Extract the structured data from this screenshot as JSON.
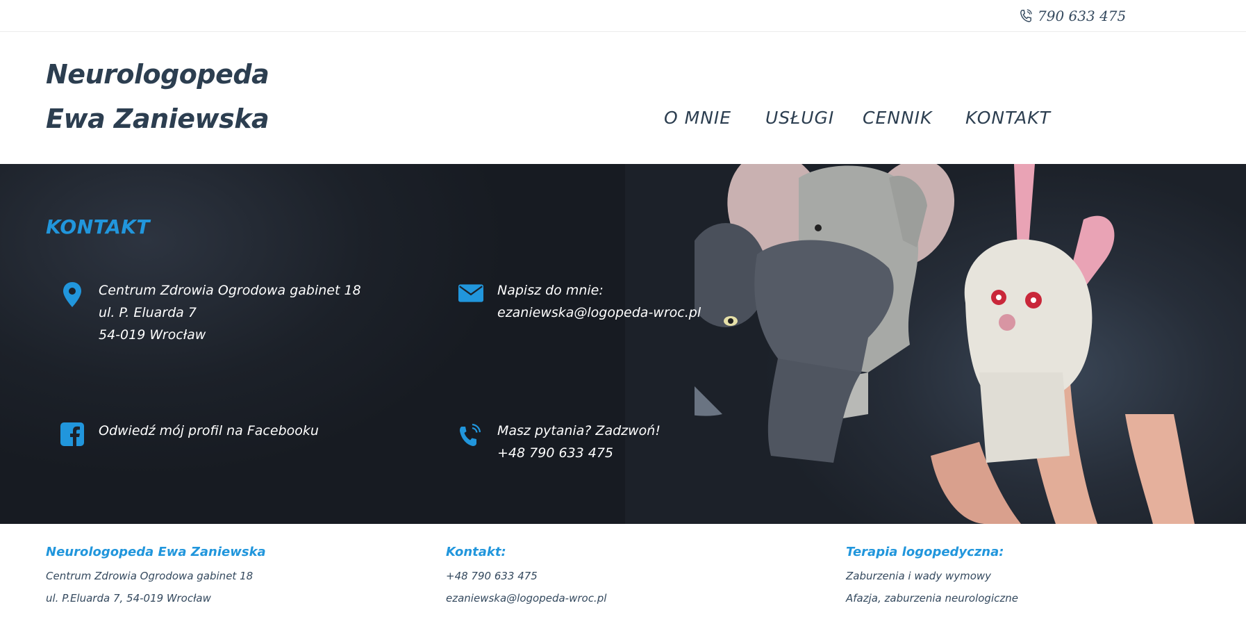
{
  "topbar": {
    "phone": "790 633 475",
    "phone_icon": "phone-icon"
  },
  "header": {
    "logo_line1": "Neurologopeda",
    "logo_line2": "Ewa Zaniewska",
    "nav": [
      {
        "label": "O MNIE"
      },
      {
        "label": "USŁUGI"
      },
      {
        "label": "CENNIK"
      },
      {
        "label": "KONTAKT"
      }
    ]
  },
  "contact": {
    "title": "KONTAKT",
    "address": {
      "icon": "map-pin-icon",
      "lines": [
        "Centrum Zdrowia Ogrodowa gabinet 18",
        "ul. P. Eluarda 7",
        "54-019 Wrocław"
      ]
    },
    "mail": {
      "icon": "envelope-icon",
      "lines": [
        "Napisz do mnie:",
        "ezaniewska@logopeda-wroc.pl"
      ]
    },
    "facebook": {
      "icon": "facebook-icon",
      "lines": [
        "Odwiedź mój profil na Facebooku"
      ]
    },
    "phone": {
      "icon": "phone-ringing-icon",
      "lines": [
        "Masz pytania? Zadzwoń!",
        "+48 790 633 475"
      ]
    }
  },
  "footer": {
    "col1": {
      "heading": "Neurologopeda Ewa Zaniewska",
      "lines": [
        "Centrum Zdrowia Ogrodowa gabinet 18",
        "ul. P.Eluarda 7, 54-019 Wrocław"
      ]
    },
    "col2": {
      "heading": "Kontakt:",
      "lines": [
        "+48 790 633 475",
        "ezaniewska@logopeda-wroc.pl"
      ]
    },
    "col3": {
      "heading": "Terapia logopedyczna:",
      "lines": [
        "Zaburzenia i wady wymowy",
        "Afazja, zaburzenia neurologiczne"
      ]
    }
  },
  "colors": {
    "accent": "#2196dc",
    "dark_text": "#2c3e50",
    "hero_bg": "#1c2129"
  }
}
